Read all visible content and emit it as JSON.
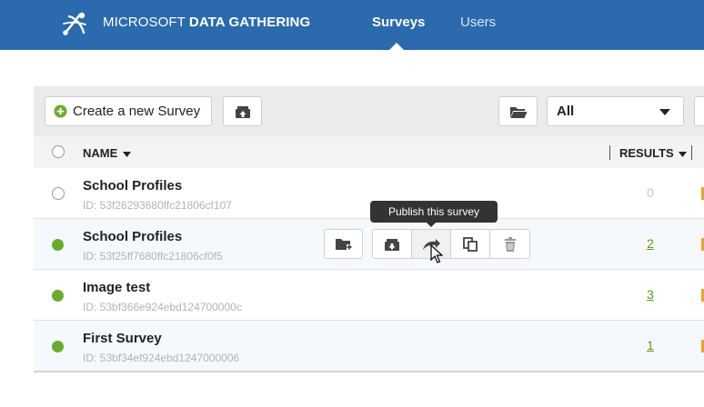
{
  "app": {
    "brand_light": "MICROSOFT",
    "brand_bold": "DATA GATHERING",
    "nav": [
      {
        "label": "Surveys",
        "active": true
      },
      {
        "label": "Users",
        "active": false
      }
    ]
  },
  "toolbar": {
    "create_label": "Create a new Survey",
    "filter_value": "All"
  },
  "table": {
    "columns": {
      "name": "NAME",
      "results": "RESULTS"
    },
    "rows": [
      {
        "name": "School Profiles",
        "id": "ID: 53f26293680ffc21806cf107",
        "results": "0",
        "published": false
      },
      {
        "name": "School Profiles",
        "id": "ID: 53f25ff7680ffc21806cf0f5",
        "results": "2",
        "published": true
      },
      {
        "name": "Image test",
        "id": "ID: 53bf366e924ebd124700000c",
        "results": "3",
        "published": true
      },
      {
        "name": "First Survey",
        "id": "ID: 53bf34ef924ebd1247000006",
        "results": "1",
        "published": true
      }
    ]
  },
  "tooltip": {
    "text": "Publish this survey"
  },
  "colors": {
    "header": "#2a6aad",
    "published": "#6aab2e",
    "link": "#5d9a1d"
  }
}
